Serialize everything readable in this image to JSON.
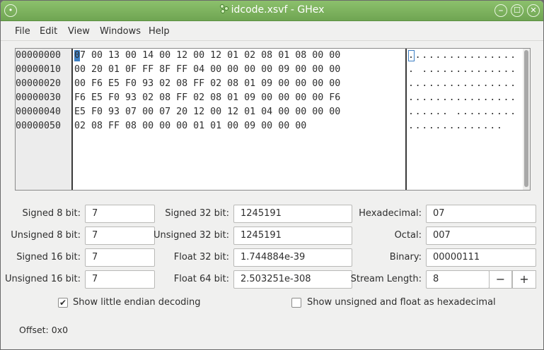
{
  "window": {
    "title": "idcode.xsvf - GHex",
    "minimize_glyph": "⎯",
    "maximize_glyph": "☐",
    "close_glyph": "✕"
  },
  "menu": [
    "File",
    "Edit",
    "View",
    "Windows",
    "Help"
  ],
  "hex": {
    "rows": [
      {
        "offset": "00000000",
        "bytes": "07 00 13 00 14 00 12 00 12 01 02 08 01 08 00 00",
        "ascii": "................"
      },
      {
        "offset": "00000010",
        "bytes": "00 20 01 0F FF 8F FF 04 00 00 00 00 09 00 00 00",
        "ascii": ". .............."
      },
      {
        "offset": "00000020",
        "bytes": "00 F6 E5 F0 93 02 08 FF 02 08 01 09 00 00 00 00",
        "ascii": "................"
      },
      {
        "offset": "00000030",
        "bytes": "F6 E5 F0 93 02 08 FF 02 08 01 09 00 00 00 00 F6",
        "ascii": "................"
      },
      {
        "offset": "00000040",
        "bytes": "E5 F0 93 07 00 07 20 12 00 12 01 04 00 00 00 00",
        "ascii": "...... ........."
      },
      {
        "offset": "00000050",
        "bytes": "02 08 FF 08 00 00 00 01 01 00 09 00 00 00",
        "ascii": ".............."
      }
    ]
  },
  "fields": {
    "signed8_label": "Signed 8 bit:",
    "signed8": "7",
    "unsigned8_label": "Unsigned 8 bit:",
    "unsigned8": "7",
    "signed16_label": "Signed 16 bit:",
    "signed16": "7",
    "unsigned16_label": "Unsigned 16 bit:",
    "unsigned16": "7",
    "signed32_label": "Signed 32 bit:",
    "signed32": "1245191",
    "unsigned32_label": "Unsigned 32 bit:",
    "unsigned32": "1245191",
    "float32_label": "Float 32 bit:",
    "float32": "1.744884e-39",
    "float64_label": "Float 64 bit:",
    "float64": "2.503251e-308",
    "hex_label": "Hexadecimal:",
    "hex": "07",
    "octal_label": "Octal:",
    "octal": "007",
    "binary_label": "Binary:",
    "binary": "00000111",
    "stream_label": "Stream Length:",
    "stream": "8",
    "minus": "−",
    "plus": "+"
  },
  "options": {
    "little_endian_label": "Show little endian decoding",
    "little_endian_checked": "✔",
    "unsigned_hex_label": "Show unsigned and float as hexadecimal"
  },
  "status": {
    "offset": "Offset: 0x0"
  }
}
